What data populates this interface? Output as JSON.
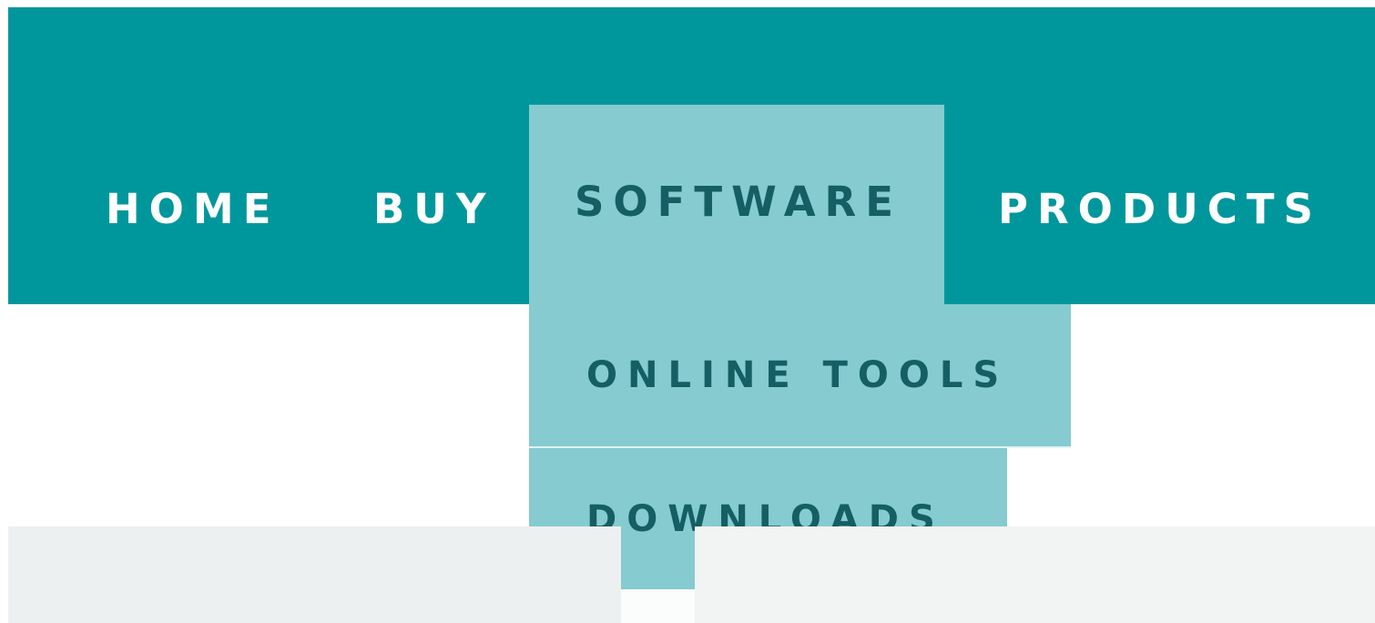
{
  "nav": {
    "items": [
      {
        "label": "HOME"
      },
      {
        "label": "BUY"
      },
      {
        "label": "SOFTWARE"
      },
      {
        "label": "PRODUCTS"
      }
    ],
    "active_index": 2,
    "dropdown": {
      "items": [
        {
          "label": "ONLINE TOOLS"
        },
        {
          "label": "DOWNLOADS"
        }
      ]
    }
  },
  "colors": {
    "navbar": "#00979c",
    "active_item": "#85cbd0",
    "active_text": "#155e63",
    "nav_text": "#ffffff",
    "content_bg": "#edf0f0"
  }
}
